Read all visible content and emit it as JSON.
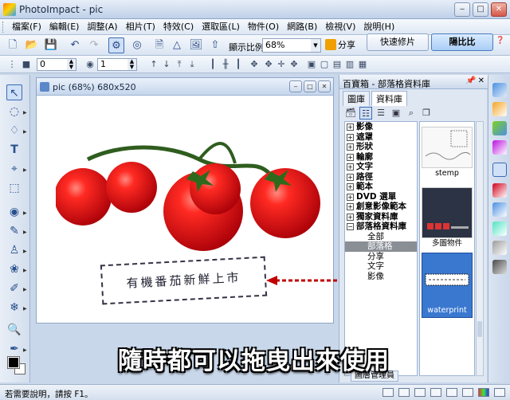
{
  "window": {
    "title": "PhotoImpact - pic"
  },
  "menu": [
    "檔案(F)",
    "編輯(E)",
    "調整(A)",
    "相片(T)",
    "特效(C)",
    "選取區(L)",
    "物件(O)",
    "網路(B)",
    "檢視(V)",
    "說明(H)"
  ],
  "toolbar": {
    "zoom_label": "顯示比例",
    "zoom_value": "68%",
    "share_label": "分享",
    "quick_mode": "快速修片",
    "full_mode": "陽比比"
  },
  "attributes": {
    "value_a": "0",
    "value_b": "1"
  },
  "document": {
    "title": "pic (68%) 680x520"
  },
  "dock": {
    "title": "百寶箱 - 部落格資料庫",
    "tabs": [
      "圖庫",
      "資料庫"
    ],
    "tree": [
      {
        "label": "影像",
        "expanded": false
      },
      {
        "label": "遮罩",
        "expanded": false
      },
      {
        "label": "形狀",
        "expanded": false
      },
      {
        "label": "輪廓",
        "expanded": false
      },
      {
        "label": "文字",
        "expanded": false
      },
      {
        "label": "路徑",
        "expanded": false
      },
      {
        "label": "範本",
        "expanded": false
      },
      {
        "label": "DVD 選單",
        "expanded": false
      },
      {
        "label": "創意影像範本",
        "expanded": false
      },
      {
        "label": "獨家資料庫",
        "expanded": false
      },
      {
        "label": "部落格資料庫",
        "expanded": true
      }
    ],
    "tree_children": [
      "全部",
      "部落格",
      "分享",
      "文字",
      "影像"
    ],
    "selected_child": "部落格",
    "thumbnails": [
      "stemp",
      "多圖物件",
      "waterprint"
    ],
    "layer_tab": "圖層管理員"
  },
  "image_text": {
    "stamp": "有機番茄新鮮上市"
  },
  "caption": "隨時都可以拖曳出來使用",
  "status": {
    "hint": "若需要說明，請按 F1。"
  },
  "colors": {
    "accent": "#3a6ab5",
    "drag_arrow": "#c00000",
    "tomato": "#e3161b"
  }
}
